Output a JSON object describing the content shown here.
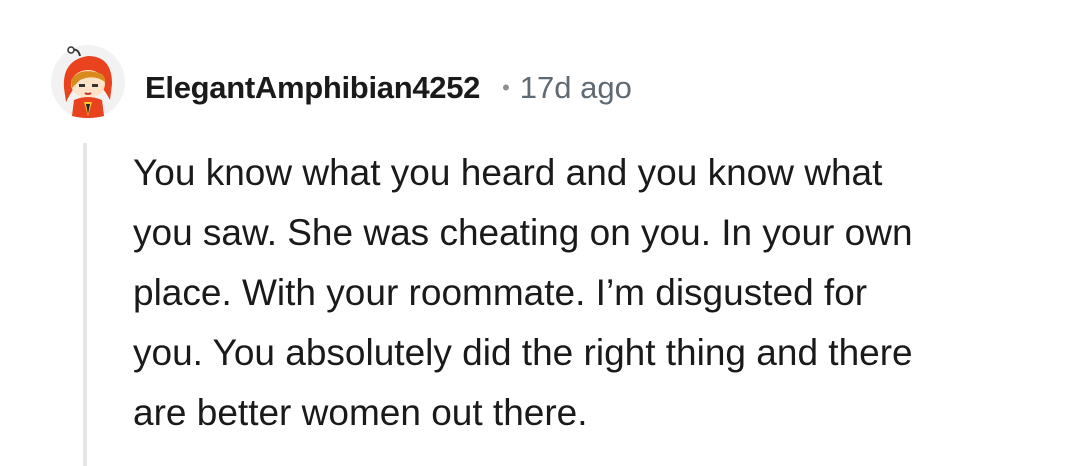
{
  "comment": {
    "author": "ElegantAmphibian4252",
    "separator": "•",
    "age": "17d ago",
    "avatar_icon": "snoo-avatar-icon",
    "lines": [
      "You know what you heard and you know what",
      "you saw. She was cheating on you. In your own",
      "place. With your roommate. I’m disgusted for",
      "you. You absolutely did the right thing and there",
      "are better women out there."
    ]
  },
  "colors": {
    "text": "#1a1a1b",
    "meta": "#5f6a72",
    "thread_line": "#e4e6e8",
    "avatar_hood": "#e8421f"
  }
}
